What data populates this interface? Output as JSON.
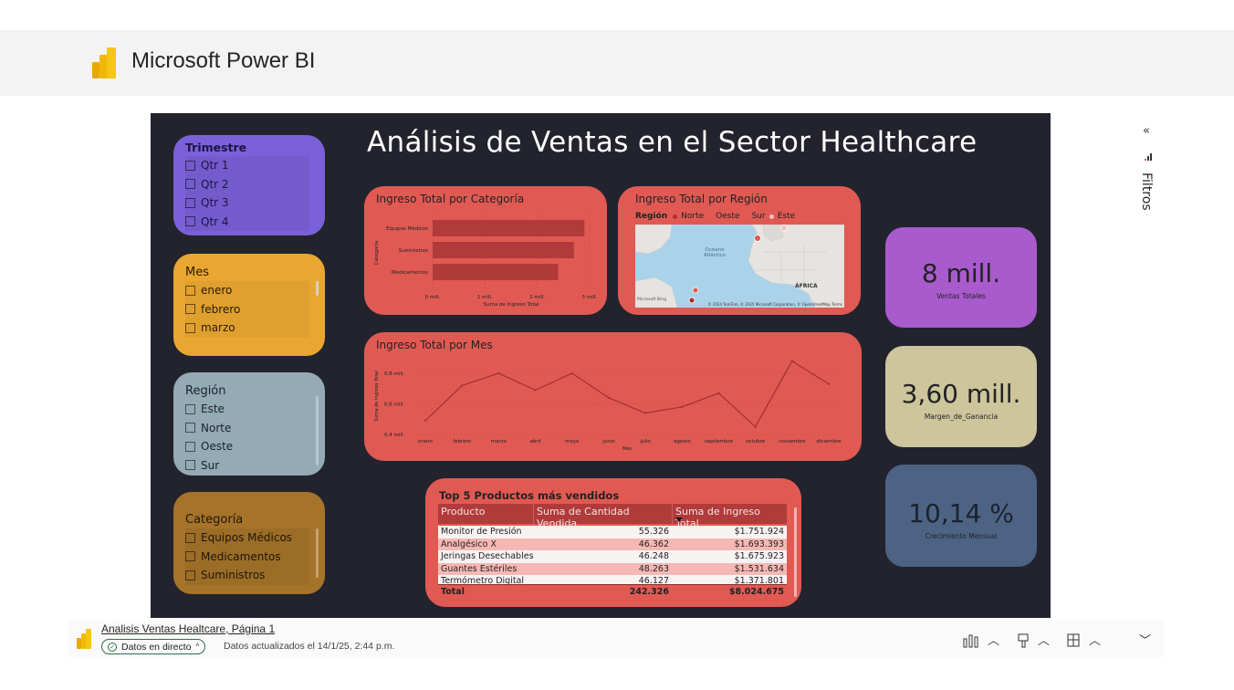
{
  "app": {
    "title": "Microsoft Power BI"
  },
  "report": {
    "title": "Análisis de Ventas en el Sector Healthcare"
  },
  "slicers": {
    "trimestre": {
      "title": "Trimestre",
      "items": [
        "Qtr 1",
        "Qtr 2",
        "Qtr 3",
        "Qtr 4"
      ],
      "color": "#7b61d9"
    },
    "mes": {
      "title": "Mes",
      "items": [
        "enero",
        "febrero",
        "marzo"
      ],
      "color": "#e9a731"
    },
    "region": {
      "title": "Región",
      "items": [
        "Este",
        "Norte",
        "Oeste",
        "Sur"
      ],
      "color": "#94aab4"
    },
    "categoria": {
      "title": "Categoría",
      "items": [
        "Equipos Médicos",
        "Medicamentos",
        "Suministros"
      ],
      "color": "#a5732a"
    }
  },
  "cat_chart": {
    "title": "Ingreso Total por Categoría",
    "ylabel": "Categoría",
    "xlabel": "Suma de Ingreso Total",
    "categories": [
      "Equipos Médicos",
      "Suministros",
      "Medicamentos"
    ],
    "values": [
      2.9,
      2.7,
      2.4
    ],
    "ticks": [
      "0 mill.",
      "1 mill.",
      "2 mill.",
      "3 mill."
    ]
  },
  "region_chart": {
    "title": "Ingreso Total por Región",
    "legend_title": "Región",
    "legend": [
      "Norte",
      "Oeste",
      "Sur",
      "Este"
    ],
    "ocean_label": "Océano Atlántico",
    "africa_label": "ÁFRICA",
    "attribution": "© 2024 TomTom, © 2025 Microsoft Corporation, © OpenStreetMap Terms",
    "ms_label": "Microsoft Bing"
  },
  "chart_data": {
    "type": "line",
    "title": "Ingreso Total por Mes",
    "xlabel": "Mes",
    "ylabel": "Suma de Ingreso Total",
    "categories": [
      "enero",
      "febrero",
      "marzo",
      "abril",
      "mayo",
      "junio",
      "julio",
      "agosto",
      "septiembre",
      "octubre",
      "noviembre",
      "diciembre"
    ],
    "values": [
      0.49,
      0.72,
      0.8,
      0.69,
      0.8,
      0.64,
      0.54,
      0.58,
      0.67,
      0.45,
      0.88,
      0.73
    ],
    "yticks": [
      "0,4 mill.",
      "0,6 mill.",
      "0,8 mill."
    ],
    "ylim": [
      0.4,
      0.8
    ]
  },
  "kpis": [
    {
      "value": "8 mill.",
      "label": "Ventas Totales",
      "color": "#a95bce"
    },
    {
      "value": "3,60 mill.",
      "label": "Margen_de_Ganancia",
      "color": "#cdc59b"
    },
    {
      "value": "10,14 %",
      "label": "Crecimiento Mensual",
      "color": "#4d6384"
    }
  ],
  "table": {
    "title": "Top 5 Productos más vendidos",
    "headers": [
      "Producto",
      "Suma de Cantidad Vendida",
      "Suma de Ingreso Total"
    ],
    "rows": [
      [
        "Monitor de Presión",
        "55.326",
        "$1.751.924"
      ],
      [
        "Analgésico X",
        "46.362",
        "$1.693.393"
      ],
      [
        "Jeringas Desechables",
        "46.248",
        "$1.675.923"
      ],
      [
        "Guantes Estériles",
        "48.263",
        "$1.531.634"
      ],
      [
        "Termómetro Digital",
        "46.127",
        "$1.371.801"
      ]
    ],
    "total": [
      "Total",
      "242.326",
      "$8.024.675"
    ]
  },
  "filters": {
    "label": "Filtros"
  },
  "footer": {
    "report_link": "Analisis Ventas Healtcare, Página 1",
    "live_label": "Datos en directo",
    "updated": "Datos actualizados el 14/1/25, 2:44 p.m."
  },
  "colors": {
    "card_red": "#e05a53",
    "bar": "#b13a3a",
    "canvas": "#22232d"
  }
}
